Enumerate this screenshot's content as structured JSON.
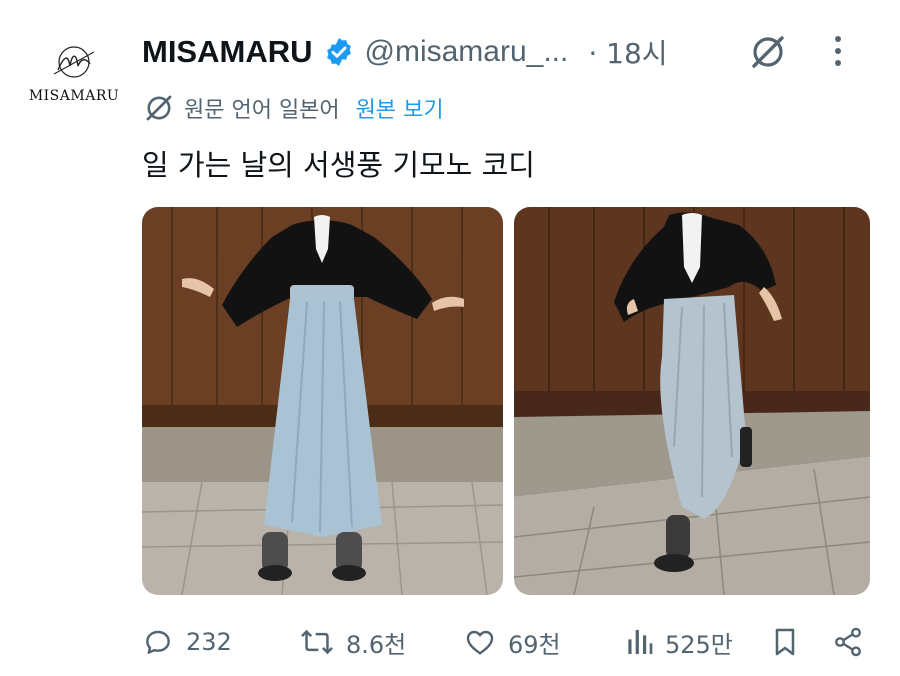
{
  "author": {
    "display_name": "MISAMARU",
    "handle": "@misamaru_...",
    "time": "· 18시",
    "avatar_text": "MISAMARU",
    "verified_color": "#1d9bf0"
  },
  "translation": {
    "label": "원문 언어 일본어",
    "view_original": "원본 보기"
  },
  "tweet": {
    "text": "일 가는 날의 서생풍 기모노 코디"
  },
  "actions": {
    "replies": "232",
    "retweets": "8.6천",
    "likes": "69천",
    "views": "525만"
  },
  "colors": {
    "text": "#0f1419",
    "secondary": "#536471",
    "accent": "#1d9bf0"
  }
}
